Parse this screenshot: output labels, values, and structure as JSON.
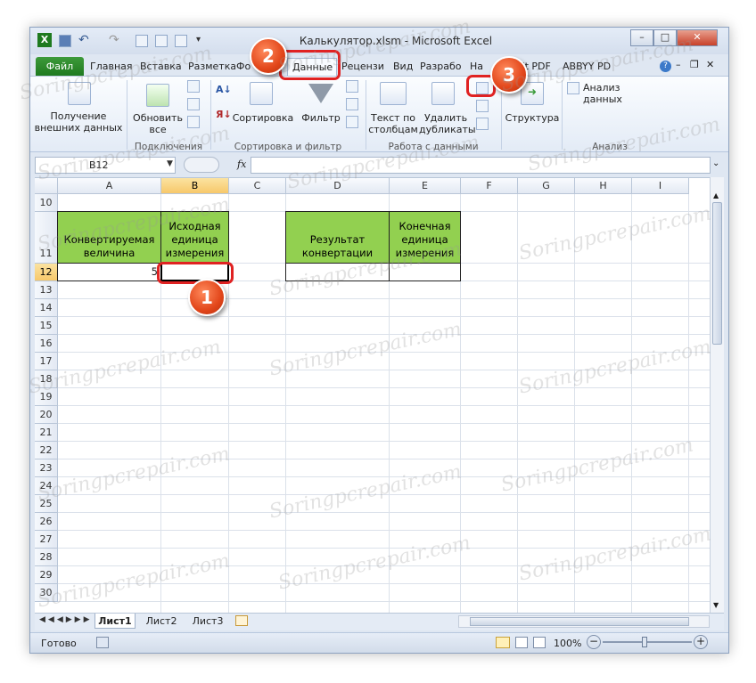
{
  "window": {
    "title": "Калькулятор.xlsm  -  Microsoft Excel",
    "controls": {
      "minimize": "–",
      "maximize": "□",
      "close": "✕"
    },
    "doc_controls": {
      "minimize": "–",
      "restore": "❐",
      "close": "✕"
    }
  },
  "ribbon_tabs": {
    "file": "Файл",
    "items": [
      "Главная",
      "Вставка",
      "Разметка",
      "Фо",
      "Данные",
      "Рецензи",
      "Вид",
      "Разрабо",
      "На",
      "xit PDF",
      "ABBYY PD"
    ]
  },
  "ribbon": {
    "get_external_data": "Получение внешних данных",
    "refresh_all": "Обновить все",
    "sort": "Сортировка",
    "filter": "Фильтр",
    "text_to_columns": "Текст по столбцам",
    "remove_duplicates": "Удалить дубликаты",
    "outline": "Структура",
    "data_analysis": "Анализ данных",
    "groups": {
      "connections": "Подключения",
      "sort_filter": "Сортировка и фильтр",
      "data_tools": "Работа с данными",
      "analysis": "Анализ"
    }
  },
  "formula_bar": {
    "name_box": "B12",
    "fx": "fx",
    "value": ""
  },
  "grid": {
    "columns": [
      "A",
      "B",
      "C",
      "D",
      "E",
      "F",
      "G",
      "H",
      "I"
    ],
    "selected_column": "B",
    "rows": [
      "10",
      "11",
      "12",
      "13",
      "14",
      "15",
      "16",
      "17",
      "18",
      "19",
      "20",
      "21",
      "22",
      "23",
      "24",
      "25",
      "26",
      "27",
      "28",
      "29",
      "30"
    ],
    "selected_row": "12",
    "cells": {
      "A11": "Конвертируемая величина",
      "B11": "Исходная единица измерения",
      "D11": "Результат конвертации",
      "E11": "Конечная единица измерения",
      "A12": "5"
    },
    "highlight_color": "#92d050"
  },
  "sheets": {
    "tabs": [
      "Лист1",
      "Лист2",
      "Лист3"
    ],
    "active": "Лист1"
  },
  "status": {
    "ready": "Готово",
    "zoom": "100%"
  },
  "callouts": [
    "1",
    "2",
    "3"
  ],
  "watermark": "Soringpcrepair.com",
  "accent_colors": {
    "callout": "#e2461a",
    "highlight_border": "#e02222",
    "file_tab": "#2a8a2a"
  }
}
